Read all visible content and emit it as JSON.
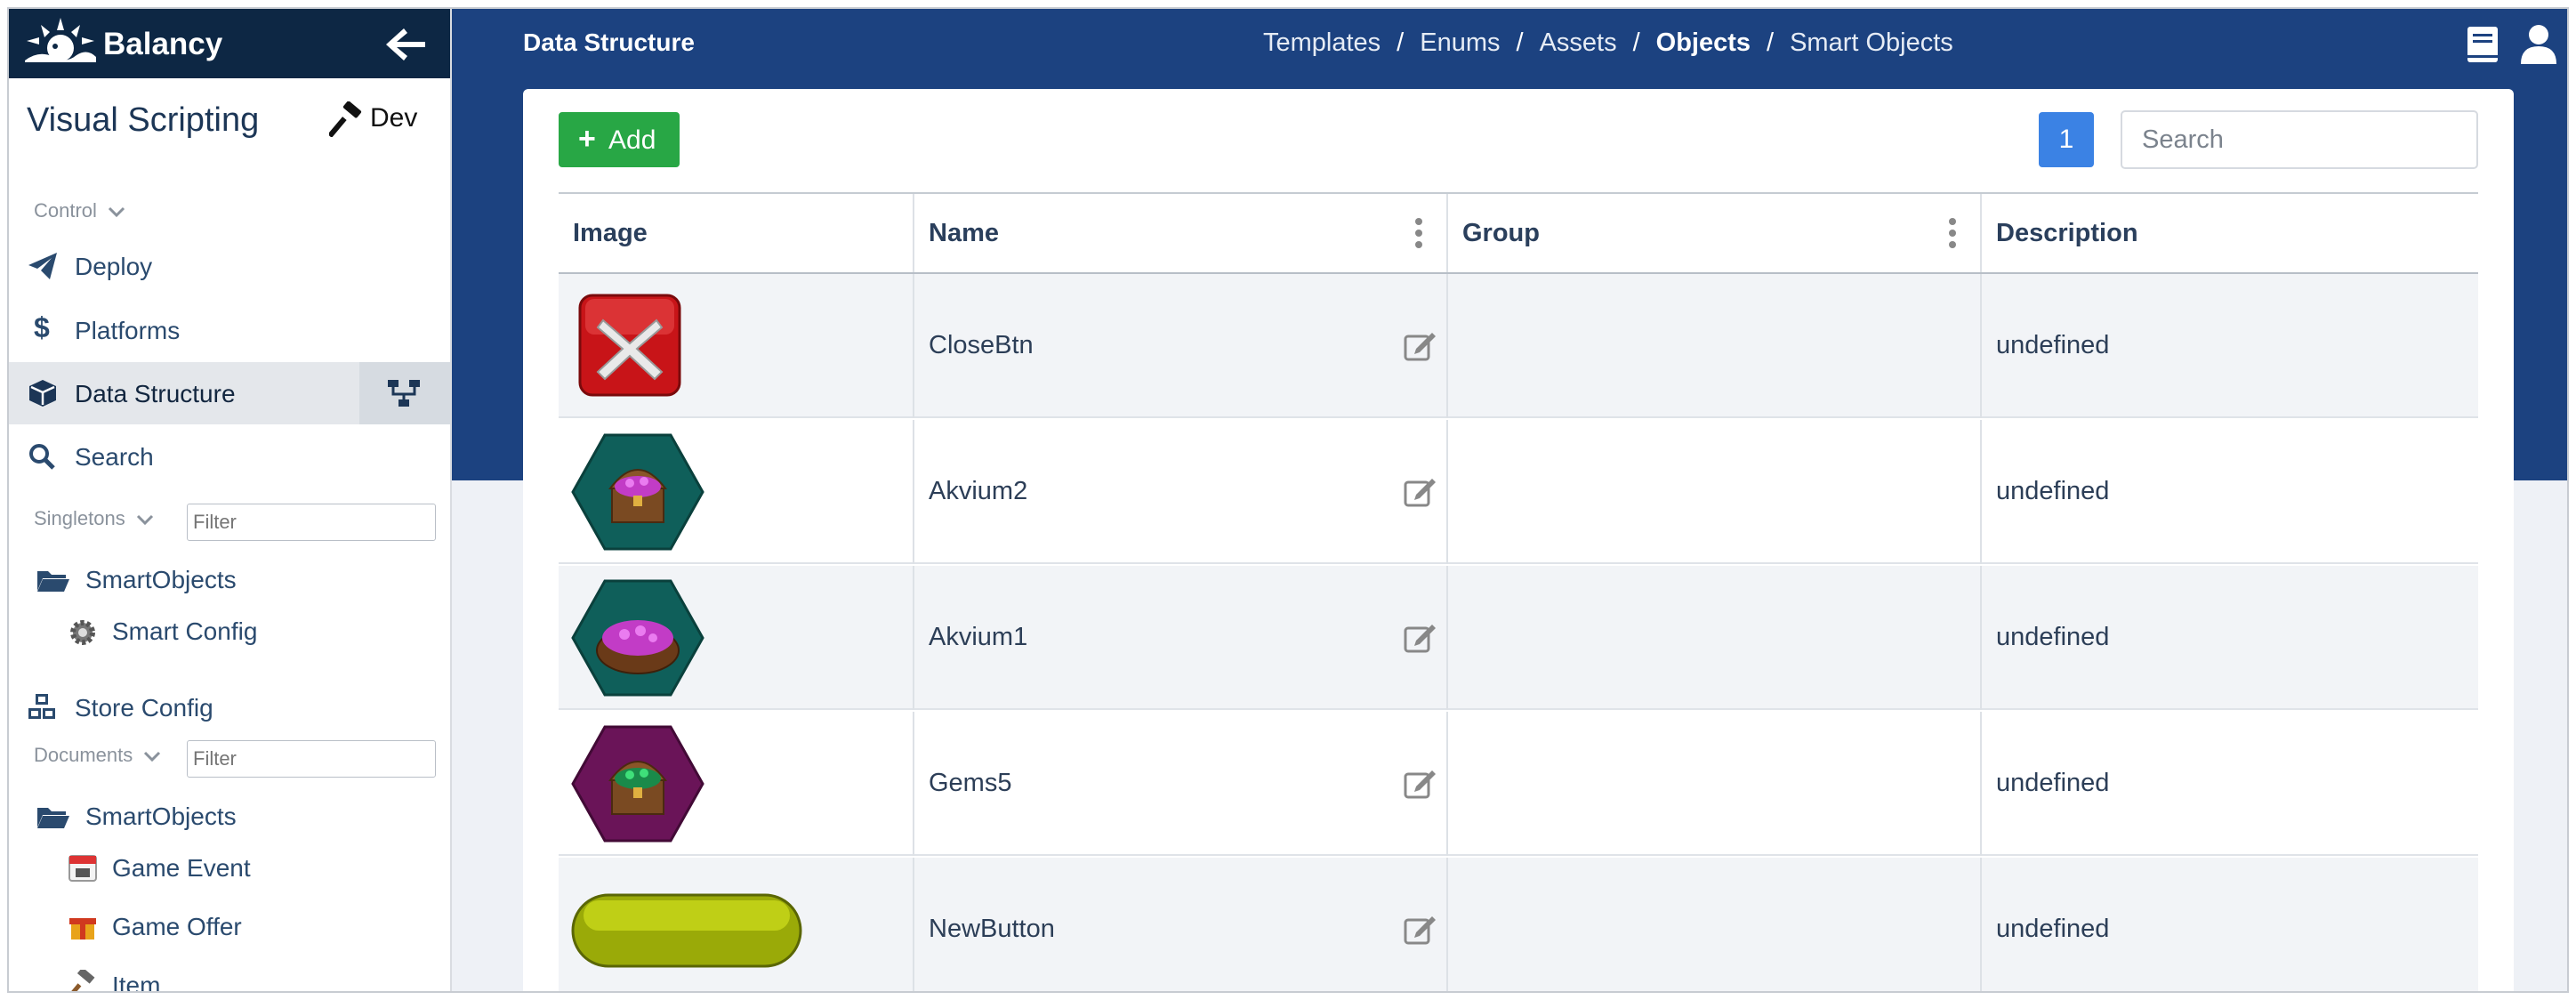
{
  "app": {
    "brand": "Balancy",
    "project_title": "Visual Scripting",
    "env_label": "Dev"
  },
  "sidebar": {
    "control_header": "Control",
    "control_items": [
      {
        "label": "Deploy",
        "icon": "paper-plane-icon"
      },
      {
        "label": "Platforms",
        "icon": "dollar-icon"
      },
      {
        "label": "Data Structure",
        "icon": "cube-icon",
        "active": true
      },
      {
        "label": "Search",
        "icon": "search-icon"
      }
    ],
    "singletons_header": "Singletons",
    "singletons_filter_placeholder": "Filter",
    "singletons_folder": "SmartObjects",
    "singletons_items": [
      {
        "label": "Smart Config",
        "icon": "gear-icon"
      }
    ],
    "store_config": "Store Config",
    "documents_header": "Documents",
    "documents_filter_placeholder": "Filter",
    "documents_folder": "SmartObjects",
    "documents_items": [
      {
        "label": "Game Event",
        "icon": "calendar-icon"
      },
      {
        "label": "Game Offer",
        "icon": "gift-icon"
      },
      {
        "label": "Item",
        "icon": "hammer-icon"
      }
    ]
  },
  "topbar": {
    "title": "Data Structure",
    "breadcrumb": [
      {
        "label": "Templates",
        "current": false
      },
      {
        "label": "Enums",
        "current": false
      },
      {
        "label": "Assets",
        "current": false
      },
      {
        "label": "Objects",
        "current": true
      },
      {
        "label": "Smart Objects",
        "current": false
      }
    ],
    "separator": "/"
  },
  "toolbar": {
    "add_label": "Add",
    "add_symbol": "+",
    "page": "1",
    "search_placeholder": "Search"
  },
  "table": {
    "columns": [
      "Image",
      "Name",
      "Group",
      "Description"
    ],
    "rows": [
      {
        "image": "close-button-image",
        "name": "CloseBtn",
        "group": "",
        "description": "undefined"
      },
      {
        "image": "treasure-chest-purple-image",
        "name": "Akvium2",
        "group": "",
        "description": "undefined"
      },
      {
        "image": "gem-bag-purple-image",
        "name": "Akvium1",
        "group": "",
        "description": "undefined"
      },
      {
        "image": "treasure-chest-green-image",
        "name": "Gems5",
        "group": "",
        "description": "undefined"
      },
      {
        "image": "green-pill-button-image",
        "name": "NewButton",
        "group": "",
        "description": "undefined"
      }
    ]
  },
  "colors": {
    "sidebar_header": "#0d2744",
    "topbar": "#1c4280",
    "add_button": "#28a745",
    "page_button": "#3b82e4"
  }
}
